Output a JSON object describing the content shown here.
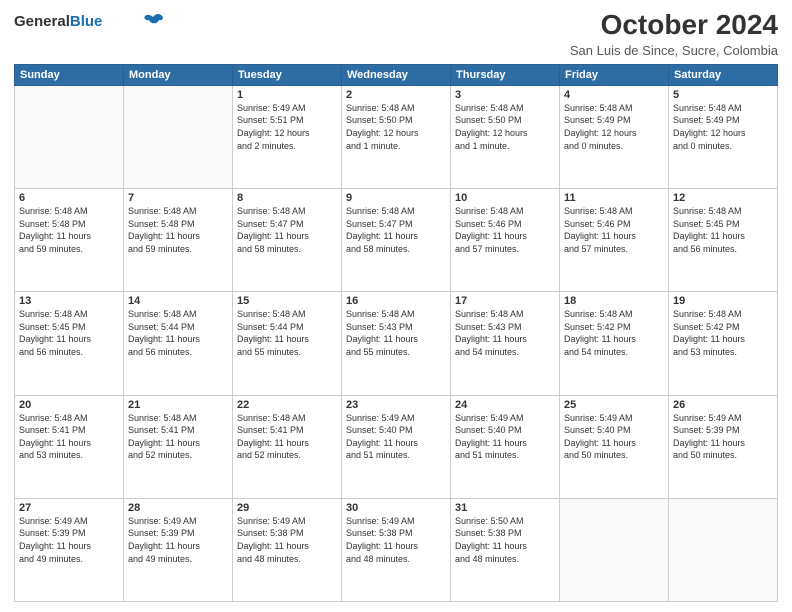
{
  "header": {
    "logo_general": "General",
    "logo_blue": "Blue",
    "month_title": "October 2024",
    "subtitle": "San Luis de Since, Sucre, Colombia"
  },
  "days_of_week": [
    "Sunday",
    "Monday",
    "Tuesday",
    "Wednesday",
    "Thursday",
    "Friday",
    "Saturday"
  ],
  "weeks": [
    [
      {
        "day": "",
        "content": ""
      },
      {
        "day": "",
        "content": ""
      },
      {
        "day": "1",
        "content": "Sunrise: 5:49 AM\nSunset: 5:51 PM\nDaylight: 12 hours\nand 2 minutes."
      },
      {
        "day": "2",
        "content": "Sunrise: 5:48 AM\nSunset: 5:50 PM\nDaylight: 12 hours\nand 1 minute."
      },
      {
        "day": "3",
        "content": "Sunrise: 5:48 AM\nSunset: 5:50 PM\nDaylight: 12 hours\nand 1 minute."
      },
      {
        "day": "4",
        "content": "Sunrise: 5:48 AM\nSunset: 5:49 PM\nDaylight: 12 hours\nand 0 minutes."
      },
      {
        "day": "5",
        "content": "Sunrise: 5:48 AM\nSunset: 5:49 PM\nDaylight: 12 hours\nand 0 minutes."
      }
    ],
    [
      {
        "day": "6",
        "content": "Sunrise: 5:48 AM\nSunset: 5:48 PM\nDaylight: 11 hours\nand 59 minutes."
      },
      {
        "day": "7",
        "content": "Sunrise: 5:48 AM\nSunset: 5:48 PM\nDaylight: 11 hours\nand 59 minutes."
      },
      {
        "day": "8",
        "content": "Sunrise: 5:48 AM\nSunset: 5:47 PM\nDaylight: 11 hours\nand 58 minutes."
      },
      {
        "day": "9",
        "content": "Sunrise: 5:48 AM\nSunset: 5:47 PM\nDaylight: 11 hours\nand 58 minutes."
      },
      {
        "day": "10",
        "content": "Sunrise: 5:48 AM\nSunset: 5:46 PM\nDaylight: 11 hours\nand 57 minutes."
      },
      {
        "day": "11",
        "content": "Sunrise: 5:48 AM\nSunset: 5:46 PM\nDaylight: 11 hours\nand 57 minutes."
      },
      {
        "day": "12",
        "content": "Sunrise: 5:48 AM\nSunset: 5:45 PM\nDaylight: 11 hours\nand 56 minutes."
      }
    ],
    [
      {
        "day": "13",
        "content": "Sunrise: 5:48 AM\nSunset: 5:45 PM\nDaylight: 11 hours\nand 56 minutes."
      },
      {
        "day": "14",
        "content": "Sunrise: 5:48 AM\nSunset: 5:44 PM\nDaylight: 11 hours\nand 56 minutes."
      },
      {
        "day": "15",
        "content": "Sunrise: 5:48 AM\nSunset: 5:44 PM\nDaylight: 11 hours\nand 55 minutes."
      },
      {
        "day": "16",
        "content": "Sunrise: 5:48 AM\nSunset: 5:43 PM\nDaylight: 11 hours\nand 55 minutes."
      },
      {
        "day": "17",
        "content": "Sunrise: 5:48 AM\nSunset: 5:43 PM\nDaylight: 11 hours\nand 54 minutes."
      },
      {
        "day": "18",
        "content": "Sunrise: 5:48 AM\nSunset: 5:42 PM\nDaylight: 11 hours\nand 54 minutes."
      },
      {
        "day": "19",
        "content": "Sunrise: 5:48 AM\nSunset: 5:42 PM\nDaylight: 11 hours\nand 53 minutes."
      }
    ],
    [
      {
        "day": "20",
        "content": "Sunrise: 5:48 AM\nSunset: 5:41 PM\nDaylight: 11 hours\nand 53 minutes."
      },
      {
        "day": "21",
        "content": "Sunrise: 5:48 AM\nSunset: 5:41 PM\nDaylight: 11 hours\nand 52 minutes."
      },
      {
        "day": "22",
        "content": "Sunrise: 5:48 AM\nSunset: 5:41 PM\nDaylight: 11 hours\nand 52 minutes."
      },
      {
        "day": "23",
        "content": "Sunrise: 5:49 AM\nSunset: 5:40 PM\nDaylight: 11 hours\nand 51 minutes."
      },
      {
        "day": "24",
        "content": "Sunrise: 5:49 AM\nSunset: 5:40 PM\nDaylight: 11 hours\nand 51 minutes."
      },
      {
        "day": "25",
        "content": "Sunrise: 5:49 AM\nSunset: 5:40 PM\nDaylight: 11 hours\nand 50 minutes."
      },
      {
        "day": "26",
        "content": "Sunrise: 5:49 AM\nSunset: 5:39 PM\nDaylight: 11 hours\nand 50 minutes."
      }
    ],
    [
      {
        "day": "27",
        "content": "Sunrise: 5:49 AM\nSunset: 5:39 PM\nDaylight: 11 hours\nand 49 minutes."
      },
      {
        "day": "28",
        "content": "Sunrise: 5:49 AM\nSunset: 5:39 PM\nDaylight: 11 hours\nand 49 minutes."
      },
      {
        "day": "29",
        "content": "Sunrise: 5:49 AM\nSunset: 5:38 PM\nDaylight: 11 hours\nand 48 minutes."
      },
      {
        "day": "30",
        "content": "Sunrise: 5:49 AM\nSunset: 5:38 PM\nDaylight: 11 hours\nand 48 minutes."
      },
      {
        "day": "31",
        "content": "Sunrise: 5:50 AM\nSunset: 5:38 PM\nDaylight: 11 hours\nand 48 minutes."
      },
      {
        "day": "",
        "content": ""
      },
      {
        "day": "",
        "content": ""
      }
    ]
  ]
}
